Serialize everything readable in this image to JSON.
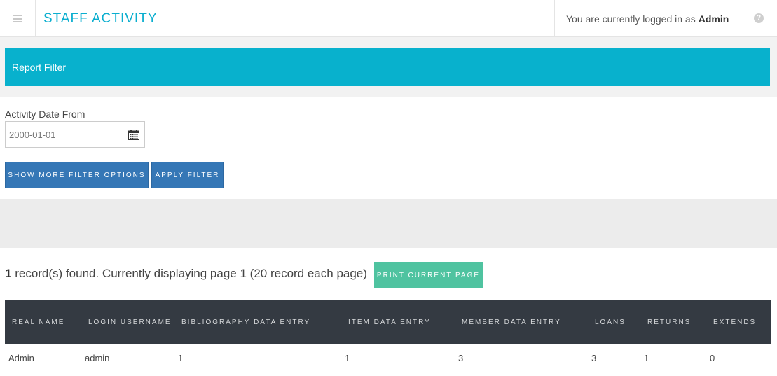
{
  "header": {
    "title": "STAFF ACTIVITY",
    "login_prefix": "You are currently logged in as",
    "login_user": "Admin"
  },
  "filter": {
    "section_title": "Report Filter",
    "date_from_label": "Activity Date From",
    "date_from_value": "2000-01-01",
    "more_options_label": "SHOW MORE FILTER OPTIONS",
    "apply_label": "APPLY FILTER"
  },
  "results": {
    "count": "1",
    "summary": "record(s) found. Currently displaying page 1 (20 record each page)",
    "print_label": "PRINT CURRENT PAGE"
  },
  "table": {
    "headers": [
      "REAL NAME",
      "LOGIN USERNAME",
      "BIBLIOGRAPHY DATA ENTRY",
      "ITEM DATA ENTRY",
      "MEMBER DATA ENTRY",
      "LOANS",
      "RETURNS",
      "EXTENDS"
    ],
    "rows": [
      [
        "Admin",
        "admin",
        "1",
        "1",
        "3",
        "3",
        "1",
        "0"
      ]
    ]
  },
  "icons": {
    "menu": "menu-icon",
    "help": "help-icon",
    "calendar": "calendar-icon"
  },
  "colors": {
    "accent": "#08b1cd",
    "primary_button": "#3577b6",
    "print_button": "#4fc3a0",
    "table_header": "#343a42"
  }
}
